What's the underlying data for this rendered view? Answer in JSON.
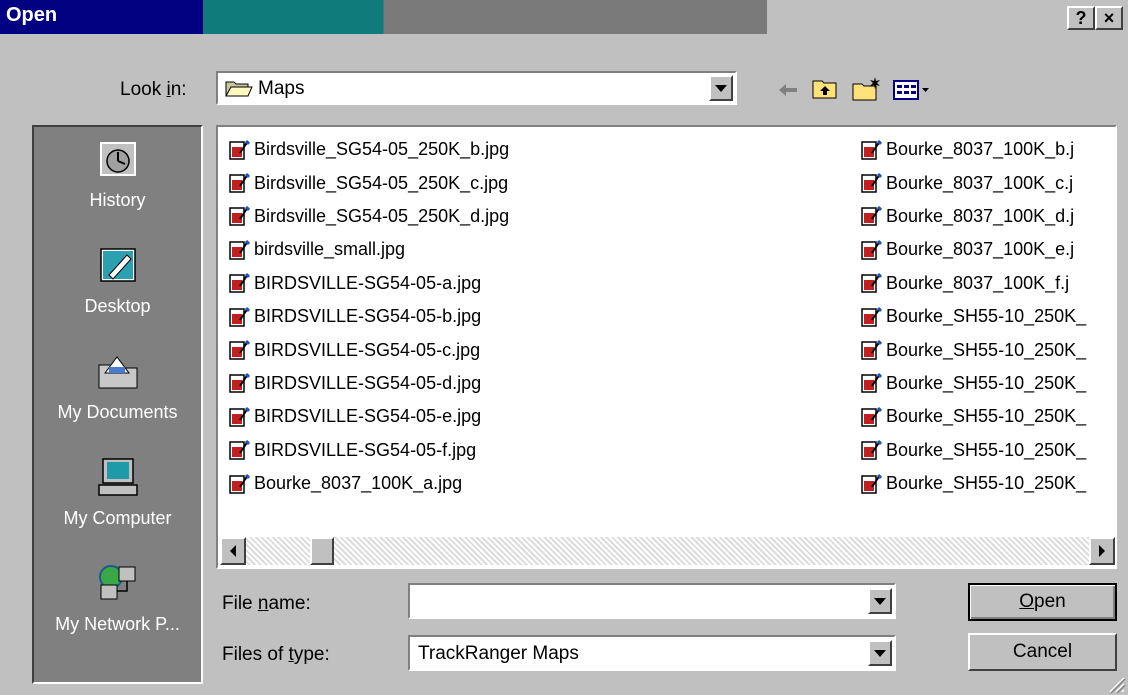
{
  "window": {
    "title": "Open",
    "help_label": "?",
    "close_label": "×"
  },
  "look_in": {
    "label_pre": "Look ",
    "label_accel": "i",
    "label_post": "n:",
    "value": "Maps"
  },
  "places": [
    {
      "label": "History",
      "icon": "history-icon"
    },
    {
      "label": "Desktop",
      "icon": "desktop-icon"
    },
    {
      "label": "My Documents",
      "icon": "my-documents-icon"
    },
    {
      "label": "My Computer",
      "icon": "my-computer-icon"
    },
    {
      "label": "My Network P...",
      "icon": "my-network-places-icon"
    }
  ],
  "files_left": [
    "Birdsville_SG54-05_250K_b.jpg",
    "Birdsville_SG54-05_250K_c.jpg",
    "Birdsville_SG54-05_250K_d.jpg",
    "birdsville_small.jpg",
    "BIRDSVILLE-SG54-05-a.jpg",
    "BIRDSVILLE-SG54-05-b.jpg",
    "BIRDSVILLE-SG54-05-c.jpg",
    "BIRDSVILLE-SG54-05-d.jpg",
    "BIRDSVILLE-SG54-05-e.jpg",
    "BIRDSVILLE-SG54-05-f.jpg",
    "Bourke_8037_100K_a.jpg"
  ],
  "files_right": [
    "Bourke_8037_100K_b.j",
    "Bourke_8037_100K_c.j",
    "Bourke_8037_100K_d.j",
    "Bourke_8037_100K_e.j",
    "Bourke_8037_100K_f.j",
    "Bourke_SH55-10_250K_",
    "Bourke_SH55-10_250K_",
    "Bourke_SH55-10_250K_",
    "Bourke_SH55-10_250K_",
    "Bourke_SH55-10_250K_",
    "Bourke_SH55-10_250K_"
  ],
  "file_name": {
    "label_pre": "File ",
    "label_accel": "n",
    "label_post": "ame:",
    "value": ""
  },
  "file_type": {
    "label_pre": "Files of ",
    "label_accel": "t",
    "label_post": "ype:",
    "value": "TrackRanger Maps"
  },
  "buttons": {
    "open_accel": "O",
    "open_rest": "pen",
    "cancel": "Cancel"
  }
}
